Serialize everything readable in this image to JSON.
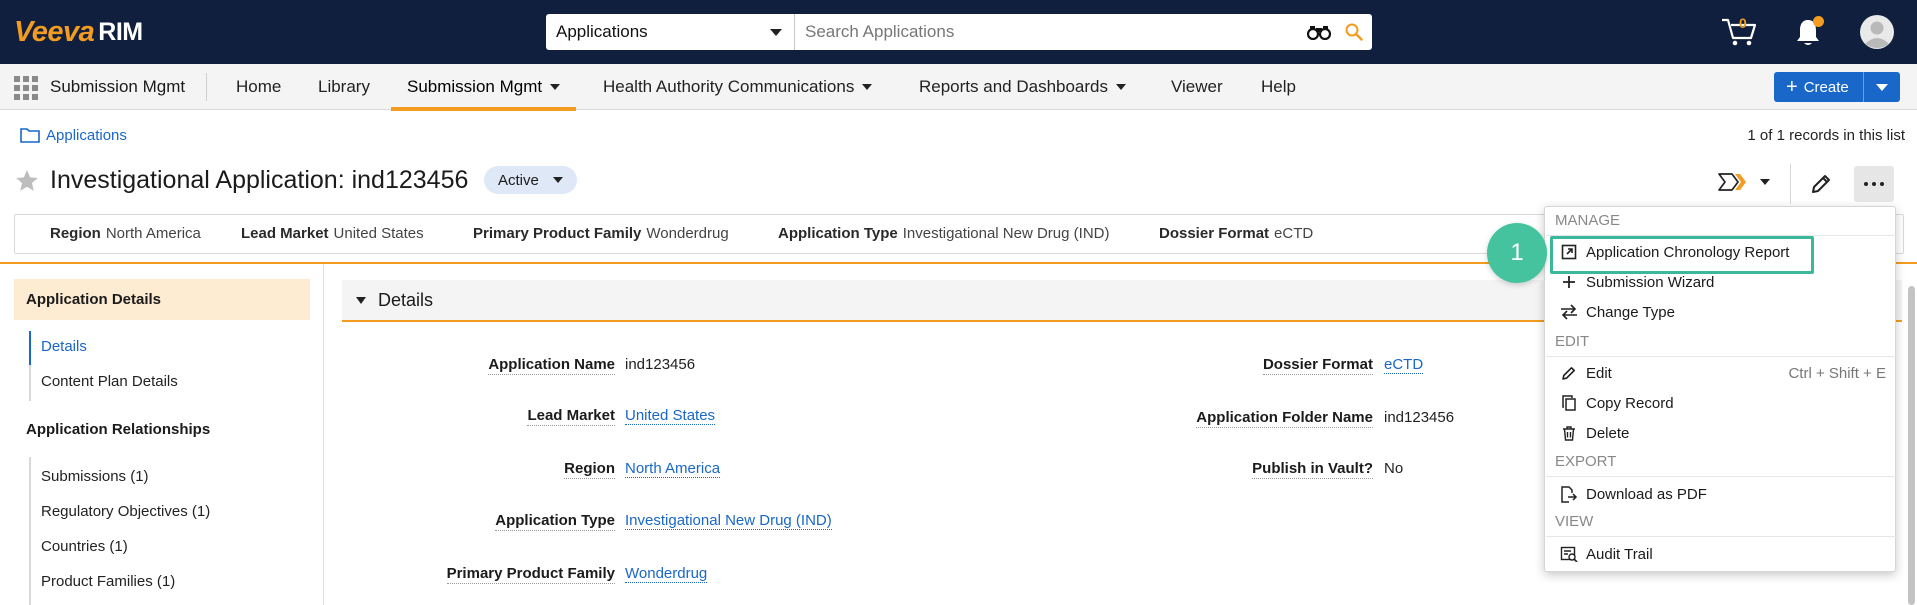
{
  "brand": {
    "logo_primary": "Veeva",
    "logo_secondary": "RIM",
    "logo_color": "#f39c1f",
    "topbar_color": "#0f1f3d"
  },
  "search": {
    "scope_value": "Applications",
    "placeholder": "Search Applications"
  },
  "topbar": {
    "cart_count": "0"
  },
  "nav": {
    "app_name": "Submission Mgmt",
    "items": [
      {
        "label": "Home"
      },
      {
        "label": "Library"
      },
      {
        "label": "Submission Mgmt"
      },
      {
        "label": "Health Authority Communications"
      },
      {
        "label": "Reports and Dashboards"
      },
      {
        "label": "Viewer"
      },
      {
        "label": "Help"
      }
    ],
    "create_label": "Create"
  },
  "breadcrumb": {
    "label": "Applications"
  },
  "records_info": "1 of 1 records in this list",
  "record": {
    "title": "Investigational Application: ind123456",
    "status": "Active"
  },
  "summary": [
    {
      "label": "Region",
      "value": "North America"
    },
    {
      "label": "Lead Market",
      "value": "United States"
    },
    {
      "label": "Primary Product Family",
      "value": "Wonderdrug"
    },
    {
      "label": "Application Type",
      "value": "Investigational New Drug (IND)"
    },
    {
      "label": "Dossier Format",
      "value": "eCTD"
    }
  ],
  "left_nav": {
    "section_title": "Application Details",
    "detail_items": [
      {
        "label": "Details"
      },
      {
        "label": "Content Plan Details"
      }
    ],
    "relationships_title": "Application Relationships",
    "relationship_items": [
      {
        "label": "Submissions (1)"
      },
      {
        "label": "Regulatory Objectives (1)"
      },
      {
        "label": "Countries (1)"
      },
      {
        "label": "Product Families (1)"
      }
    ]
  },
  "details": {
    "section_label": "Details",
    "left_fields": [
      {
        "label": "Application Name",
        "value": "ind123456"
      },
      {
        "label": "Lead Market",
        "value": "United States"
      },
      {
        "label": "Region",
        "value": "North America"
      },
      {
        "label": "Application Type",
        "value": "Investigational New Drug (IND)"
      },
      {
        "label": "Primary Product Family",
        "value": "Wonderdrug"
      }
    ],
    "right_fields": [
      {
        "label": "Dossier Format",
        "value": "eCTD"
      },
      {
        "label": "Application Folder Name",
        "value": "ind123456"
      },
      {
        "label": "Publish in Vault?",
        "value": "No"
      }
    ]
  },
  "menu": {
    "sections": [
      {
        "title": "MANAGE",
        "items": [
          {
            "label": "Application Chronology Report",
            "icon": "external-link-icon"
          },
          {
            "label": "Submission Wizard",
            "icon": "plus-icon"
          },
          {
            "label": "Change Type",
            "icon": "swap-arrows-icon"
          }
        ]
      },
      {
        "title": "EDIT",
        "items": [
          {
            "label": "Edit",
            "icon": "pencil-icon",
            "shortcut": "Ctrl + Shift + E"
          },
          {
            "label": "Copy Record",
            "icon": "copy-icon"
          },
          {
            "label": "Delete",
            "icon": "trash-icon"
          }
        ]
      },
      {
        "title": "EXPORT",
        "items": [
          {
            "label": "Download as PDF",
            "icon": "download-pdf-icon"
          }
        ]
      },
      {
        "title": "VIEW",
        "items": [
          {
            "label": "Audit Trail",
            "icon": "audit-trail-icon"
          }
        ]
      }
    ]
  },
  "annotation": {
    "step": "1",
    "color": "#45c39e"
  },
  "colors": {
    "accent": "#f39c1f",
    "link": "#1967c9",
    "primary_button": "#1967c9"
  }
}
